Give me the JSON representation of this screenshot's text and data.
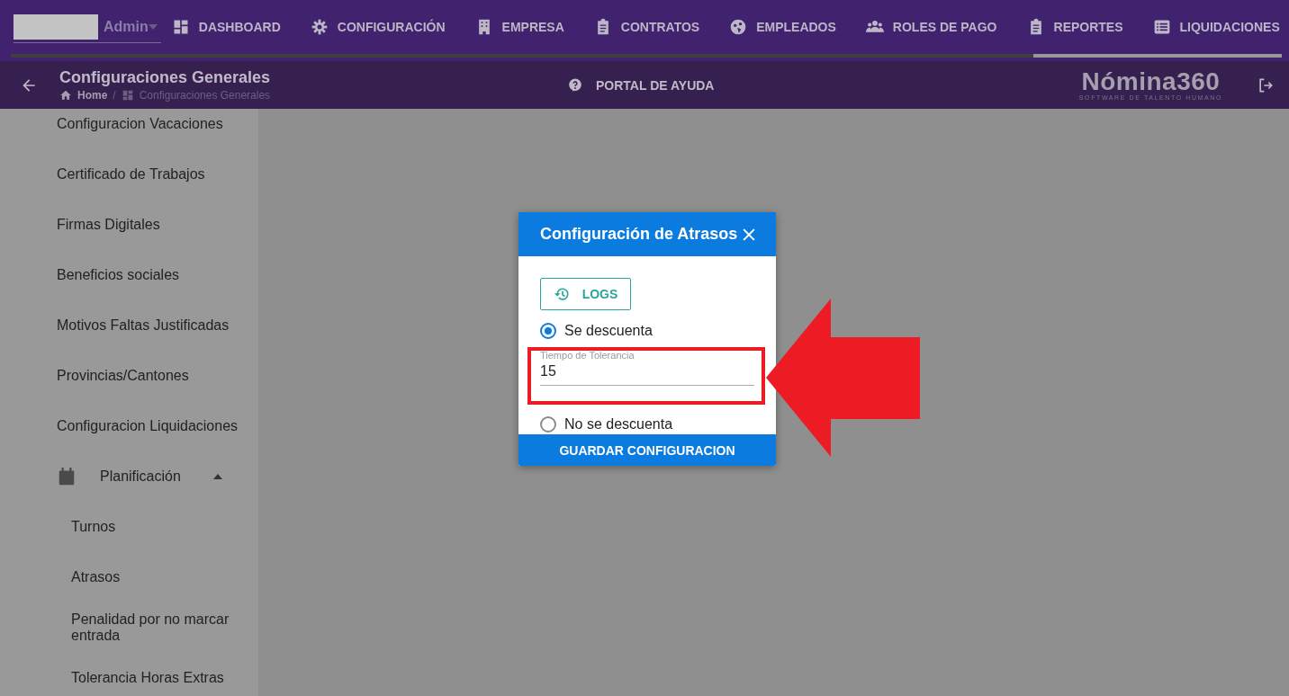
{
  "nav": {
    "user": "Admin",
    "items": [
      {
        "label": "DASHBOARD"
      },
      {
        "label": "CONFIGURACIÓN"
      },
      {
        "label": "EMPRESA"
      },
      {
        "label": "CONTRATOS"
      },
      {
        "label": "EMPLEADOS"
      },
      {
        "label": "ROLES DE PAGO"
      },
      {
        "label": "REPORTES"
      },
      {
        "label": "LIQUIDACIONES"
      }
    ]
  },
  "header": {
    "title": "Configuraciones Generales",
    "breadcrumb": [
      "Home",
      "Configuraciones Generales"
    ],
    "breadcrumb_separator": "/",
    "help": "PORTAL DE AYUDA",
    "logo": {
      "name": "Nómina360",
      "tagline": "SOFTWARE DE TALENTO HUMANO"
    }
  },
  "sidebar": {
    "items": [
      {
        "label": "Configuracion Vacaciones"
      },
      {
        "label": "Certificado de Trabajos"
      },
      {
        "label": "Firmas Digitales"
      },
      {
        "label": "Beneficios sociales"
      },
      {
        "label": "Motivos Faltas Justificadas"
      },
      {
        "label": "Provincias/Cantones"
      },
      {
        "label": "Configuracion Liquidaciones"
      },
      {
        "label": "Planificación",
        "expanded": true,
        "children": [
          {
            "label": "Turnos"
          },
          {
            "label": "Atrasos"
          },
          {
            "label": "Penalidad por no marcar entrada"
          },
          {
            "label": "Tolerancia Horas Extras"
          }
        ]
      }
    ]
  },
  "dialog": {
    "title": "Configuración de Atrasos",
    "logs_button": "LOGS",
    "options": [
      {
        "label": "Se descuenta",
        "selected": true
      },
      {
        "label": "No se descuenta",
        "selected": false
      }
    ],
    "field": {
      "label": "Tiempo de Tolerancia",
      "value": "15"
    },
    "save_button": "GUARDAR CONFIGURACION"
  }
}
